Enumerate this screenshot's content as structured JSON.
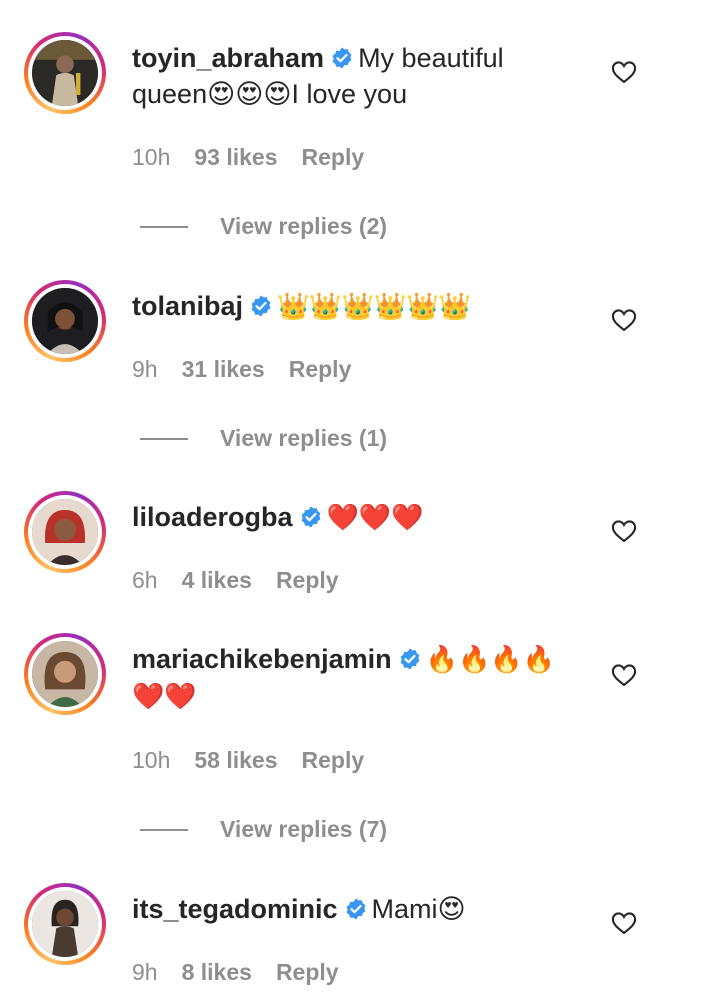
{
  "comments": [
    {
      "username": "toyin_abraham",
      "text_lines": [
        "My beautiful",
        "queen😍😍😍I love you"
      ],
      "time": "10h",
      "likes": "93 likes",
      "reply": "Reply",
      "view_replies": "View replies (2)",
      "avatar_color": "#3a3328"
    },
    {
      "username": "tolanibaj",
      "text_lines": [
        "👑👑👑👑👑👑"
      ],
      "time": "9h",
      "likes": "31 likes",
      "reply": "Reply",
      "view_replies": "View replies (1)",
      "avatar_color": "#2a2a2a"
    },
    {
      "username": "liloaderogba",
      "text_lines": [
        "❤️❤️❤️"
      ],
      "time": "6h",
      "likes": "4 likes",
      "reply": "Reply",
      "view_replies": "",
      "avatar_color": "#b2463a"
    },
    {
      "username": "mariachikebenjamin",
      "text_lines": [
        "🔥🔥🔥🔥",
        "❤️❤️"
      ],
      "time": "10h",
      "likes": "58 likes",
      "reply": "Reply",
      "view_replies": "View replies (7)",
      "avatar_color": "#7a5a45"
    },
    {
      "username": "its_tegadominic",
      "text_lines": [
        "Mami😍"
      ],
      "time": "9h",
      "likes": "8 likes",
      "reply": "Reply",
      "view_replies": "",
      "avatar_color": "#3b342e"
    }
  ],
  "icons": {
    "verified": "verified-badge-icon",
    "like": "heart-outline-icon"
  },
  "colors": {
    "verified_blue": "#3897f0",
    "meta_gray": "#8e8e8e",
    "text": "#262626"
  }
}
